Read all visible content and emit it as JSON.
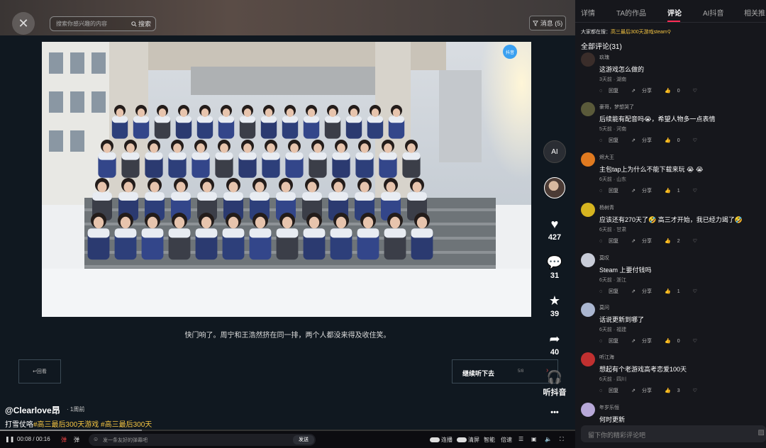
{
  "header": {
    "close_icon": "close-icon",
    "search_placeholder": "搜索你感兴趣的内容",
    "search_label": "搜索",
    "messages_label": "消息 (5)"
  },
  "video": {
    "ai_badge": "抖音",
    "caption": "快门响了。周宁和王浩然挤在同一排，两个人都没来得及收住笑。",
    "back_label": "↩回看",
    "continue_label": "继续听下去",
    "continue_page": "5/8",
    "continue_arrow": "›"
  },
  "actions": {
    "ai_label": "AI",
    "likes": "427",
    "comments": "31",
    "favorites": "39",
    "shares": "40",
    "listen_label": "听抖音",
    "more_label": "•••"
  },
  "info": {
    "author": "@Clearlove昂",
    "time_ago": "· 1周前",
    "desc_prefix": "打雪仗咯",
    "tag1": "#高三最后300天游戏",
    "tag2": "#高三最后300天"
  },
  "controls": {
    "time": "00:08 / 00:16",
    "progress": 0.5,
    "danmu_placeholder": "发一条友好的弹幕吧",
    "danmu_send": "发送",
    "autoplay": "连播",
    "clear": "清屏",
    "smart": "智能",
    "speed": "倍速"
  },
  "panel": {
    "tabs": [
      "详情",
      "TA的作品",
      "评论",
      "AI抖音",
      "相关推"
    ],
    "active_tab": 2,
    "searching_prefix": "大家都在搜：",
    "searching_term": "高三最后300天游戏steam",
    "all_comments": "全部评论(31)",
    "reply_placeholder": "留下你的精彩评论吧",
    "reply_label": "回复",
    "share_label": "分享",
    "comments": [
      {
        "user": "玖瑰",
        "text": "这游戏怎么做的",
        "time": "3天前 · 湖南",
        "likes": "0",
        "avatar_color": "#3a2d2a"
      },
      {
        "user": "豪哥，梦想哭了",
        "text": "后续能有配音吗😭，希望人物多一点表情",
        "time": "5天前 · 河南",
        "likes": "0",
        "avatar_color": "#5a5a3a"
      },
      {
        "user": "烬大王",
        "text": "主包tap上为什么不能下载来玩 😭 😭",
        "time": "6天前 · 山东",
        "likes": "1",
        "avatar_color": "#e07a20"
      },
      {
        "user": "杨树青",
        "text": "应该还有270天了🤣 高三才开始，我已经力竭了🤣",
        "time": "6天前 · 甘肃",
        "likes": "2",
        "avatar_color": "#d6b420"
      },
      {
        "user": "莫叹",
        "text": "Steam 上要付钱吗",
        "time": "6天前 · 浙江",
        "likes": "1",
        "avatar_color": "#c8ccd8"
      },
      {
        "user": "莫问",
        "text": "话说更新到哪了",
        "time": "6天前 · 福建",
        "likes": "0",
        "avatar_color": "#aab6d0"
      },
      {
        "user": "听江海",
        "text": "想起有个老游戏高考恋爱100天",
        "time": "6天前 · 四川",
        "likes": "3",
        "avatar_color": "#c03030"
      },
      {
        "user": "年岁乐恒",
        "text": "何时更新",
        "time": "",
        "likes": "",
        "avatar_color": "#b7a8d8"
      }
    ]
  }
}
